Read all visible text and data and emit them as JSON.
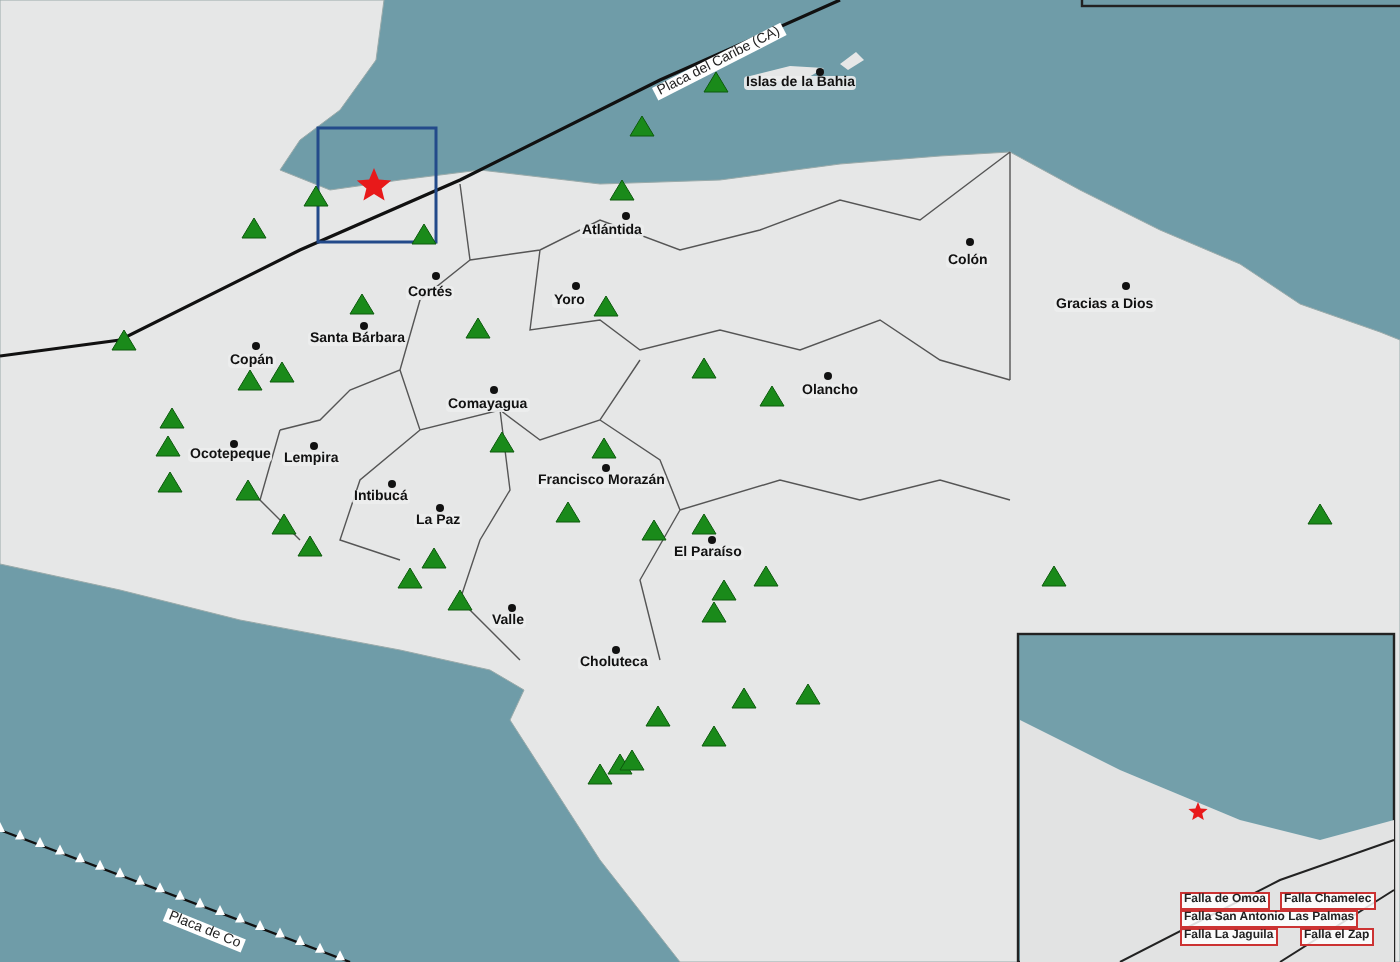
{
  "map": {
    "plate_labels": [
      "Placa del Caribe (CA)",
      "Placa de Co"
    ],
    "departments": [
      {
        "name": "Islas de la Bahia"
      },
      {
        "name": "Atlántida"
      },
      {
        "name": "Colón"
      },
      {
        "name": "Gracias a Dios"
      },
      {
        "name": "Cortés"
      },
      {
        "name": "Yoro"
      },
      {
        "name": "Santa Bárbara"
      },
      {
        "name": "Copán"
      },
      {
        "name": "Olancho"
      },
      {
        "name": "Comayagua"
      },
      {
        "name": "Ocotepeque"
      },
      {
        "name": "Lempira"
      },
      {
        "name": "Intibucá"
      },
      {
        "name": "La Paz"
      },
      {
        "name": "Francisco Morazán"
      },
      {
        "name": "El Paraíso"
      },
      {
        "name": "Valle"
      },
      {
        "name": "Choluteca"
      }
    ],
    "inset": {
      "fault_labels": [
        "Falla de Omoa",
        "Falla Chamelec",
        "Falla San Antonio Las Palmas",
        "Falla La Jaguila",
        "Falla el Zap"
      ]
    }
  }
}
